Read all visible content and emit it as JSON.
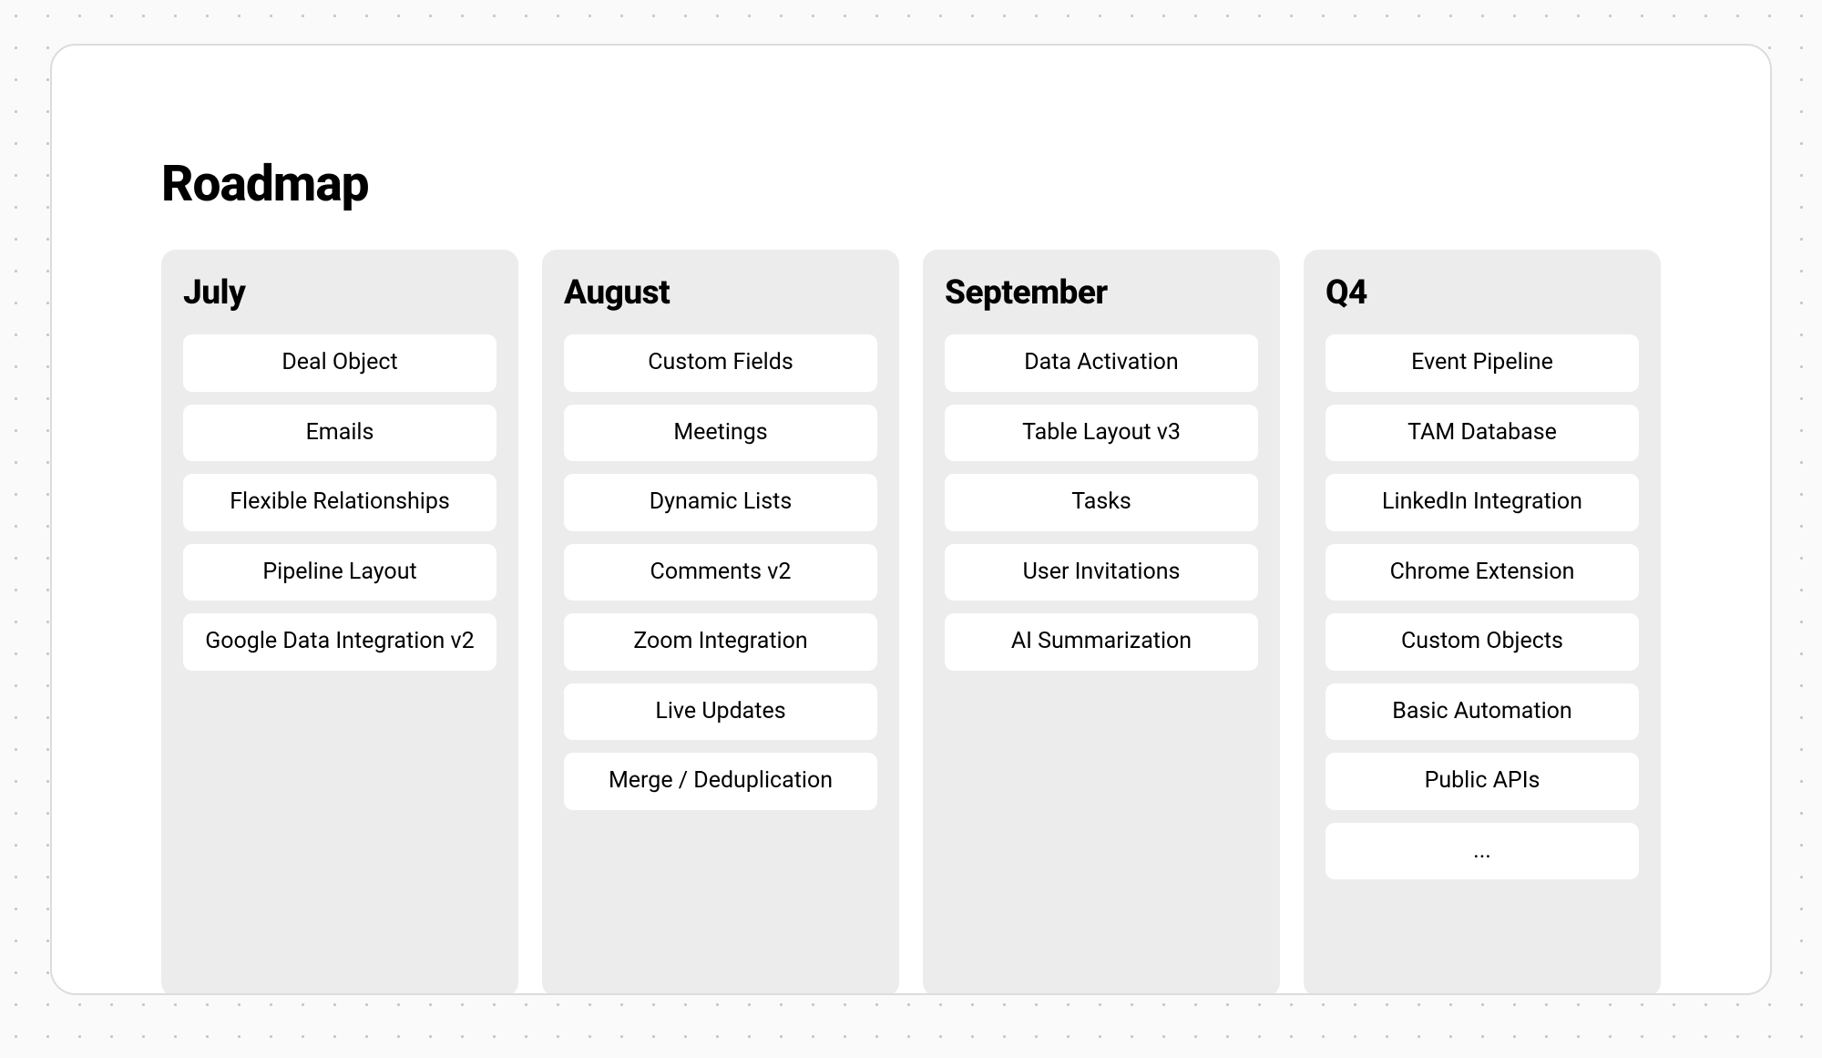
{
  "title": "Roadmap",
  "columns": [
    {
      "title": "July",
      "items": [
        "Deal Object",
        "Emails",
        "Flexible Relationships",
        "Pipeline Layout",
        "Google Data Integration v2"
      ]
    },
    {
      "title": "August",
      "items": [
        "Custom Fields",
        "Meetings",
        "Dynamic Lists",
        "Comments v2",
        "Zoom Integration",
        "Live Updates",
        "Merge / Deduplication"
      ]
    },
    {
      "title": "September",
      "items": [
        "Data Activation",
        "Table Layout v3",
        "Tasks",
        "User Invitations",
        "AI Summarization"
      ]
    },
    {
      "title": "Q4",
      "items": [
        "Event Pipeline",
        "TAM Database",
        "LinkedIn Integration",
        "Chrome Extension",
        "Custom Objects",
        "Basic Automation",
        "Public APIs",
        "..."
      ]
    }
  ]
}
